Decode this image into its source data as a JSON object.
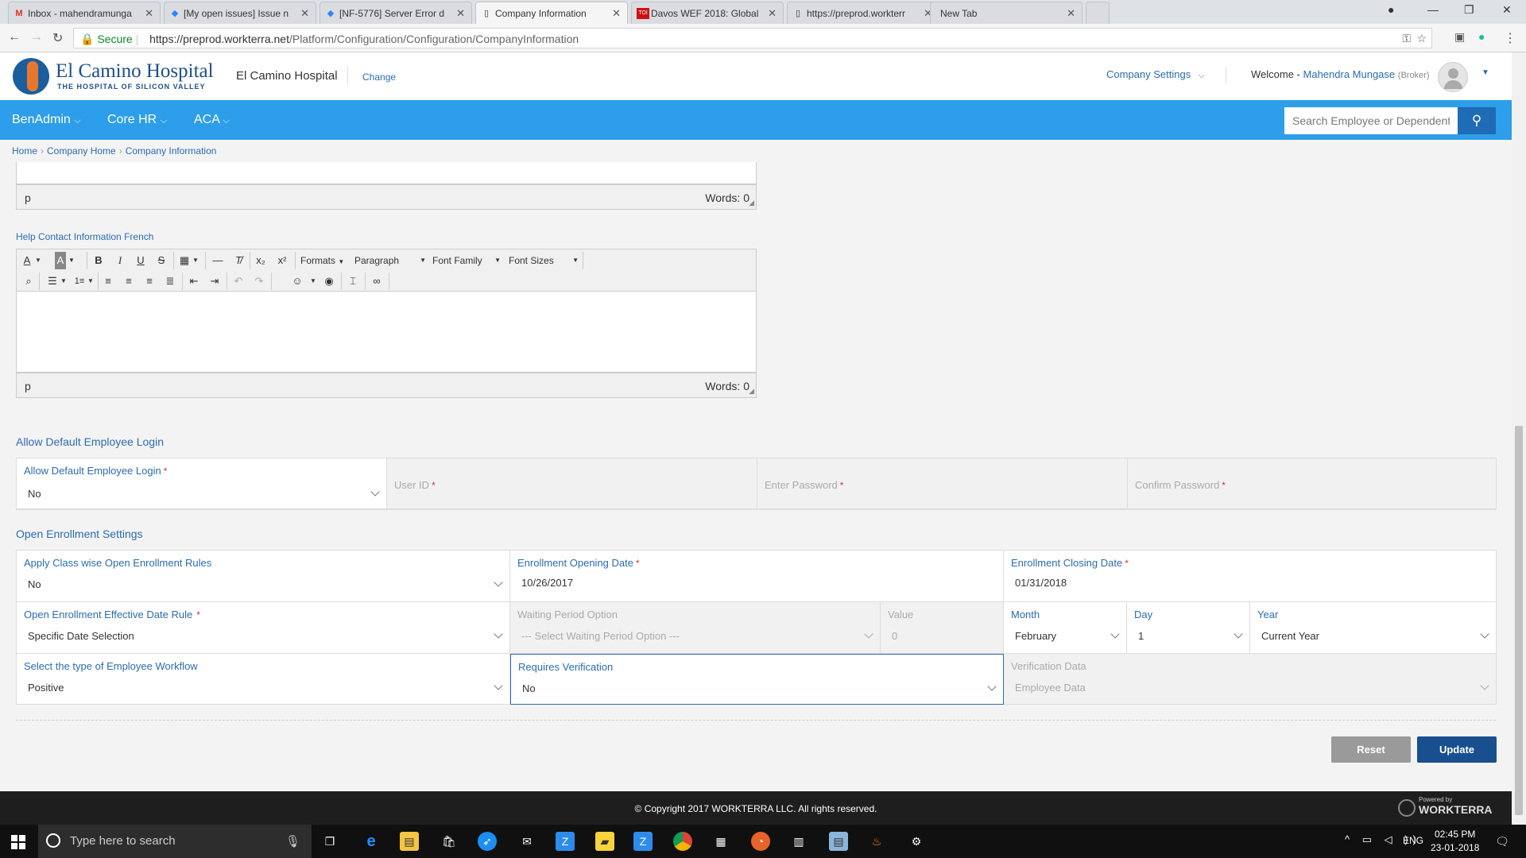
{
  "browser": {
    "tabs": [
      {
        "title": "Inbox - mahendramunga",
        "icon": "gmail-icon",
        "fav": "M",
        "favcolor": "#d93025"
      },
      {
        "title": "[My open issues] Issue n",
        "icon": "jira-icon",
        "fav": "◆",
        "favcolor": "#2684ff"
      },
      {
        "title": "[NF-5776] Server Error d",
        "icon": "jira-icon",
        "fav": "◆",
        "favcolor": "#2684ff"
      },
      {
        "title": "Company Information",
        "icon": "page-icon",
        "fav": "▯",
        "favcolor": "#666"
      },
      {
        "title": "Davos WEF 2018: Global",
        "icon": "toi-icon",
        "fav": "TOI",
        "favcolor": "#c11"
      },
      {
        "title": "https://preprod.workterr",
        "icon": "page-icon",
        "fav": "▯",
        "favcolor": "#666"
      },
      {
        "title": "New Tab",
        "icon": "",
        "fav": "",
        "favcolor": "#666"
      }
    ],
    "secure_label": "Secure",
    "url_host": "https://preprod.workterra.net",
    "url_path": "/Platform/Configuration/Configuration/CompanyInformation"
  },
  "header": {
    "logo_name": "El Camino Hospital",
    "logo_tagline": "THE HOSPITAL OF SILICON VALLEY",
    "company_name": "El Camino Hospital",
    "change_link": "Change",
    "company_settings": "Company Settings",
    "welcome_prefix": "Welcome -",
    "user_name": "Mahendra Mungase",
    "user_role": "(Broker)"
  },
  "nav": {
    "items": [
      "BenAdmin",
      "Core HR",
      "ACA"
    ],
    "search_placeholder": "Search Employee or Dependent"
  },
  "breadcrumb": [
    "Home",
    "Company Home",
    "Company Information"
  ],
  "editor_prev": {
    "path": "p",
    "words": "Words: 0"
  },
  "help_french": {
    "label": "Help Contact Information French",
    "toolbar": {
      "formats": "Formats",
      "paragraph": "Paragraph",
      "font_family": "Font Family",
      "font_sizes": "Font Sizes"
    },
    "path": "p",
    "words": "Words: 0"
  },
  "default_login": {
    "title": "Allow Default Employee Login",
    "fields": [
      {
        "label": "Allow Default Employee Login",
        "value": "No"
      },
      {
        "label": "User ID",
        "value": ""
      },
      {
        "label": "Enter Password",
        "value": ""
      },
      {
        "label": "Confirm Password",
        "value": ""
      }
    ]
  },
  "open_enrollment": {
    "title": "Open Enrollment Settings",
    "apply_class": {
      "label": "Apply Class wise Open Enrollment Rules",
      "value": "No"
    },
    "opening_date": {
      "label": "Enrollment Opening Date",
      "value": "10/26/2017"
    },
    "closing_date": {
      "label": "Enrollment Closing Date",
      "value": "01/31/2018"
    },
    "effective_rule": {
      "label": "Open Enrollment Effective Date Rule",
      "value": "Specific Date Selection"
    },
    "waiting_period": {
      "label": "Waiting Period Option",
      "value": "--- Select Waiting Period Option ---"
    },
    "value_field": {
      "label": "Value",
      "value": "0"
    },
    "month": {
      "label": "Month",
      "value": "February"
    },
    "day": {
      "label": "Day",
      "value": "1"
    },
    "year": {
      "label": "Year",
      "value": "Current Year"
    },
    "workflow": {
      "label": "Select the type of Employee Workflow",
      "value": "Positive"
    },
    "requires_verification": {
      "label": "Requires Verification",
      "value": "No"
    },
    "verification_data": {
      "label": "Verification Data",
      "value": "Employee Data"
    }
  },
  "actions": {
    "reset": "Reset",
    "update": "Update"
  },
  "footer": {
    "copyright": "© Copyright 2017 WORKTERRA LLC. All rights reserved.",
    "powered_by": "Powered by",
    "brand": "WORKTERRA"
  },
  "taskbar": {
    "search_placeholder": "Type here to search",
    "lang": "ENG",
    "time": "02:45 PM",
    "date": "23-01-2018"
  }
}
